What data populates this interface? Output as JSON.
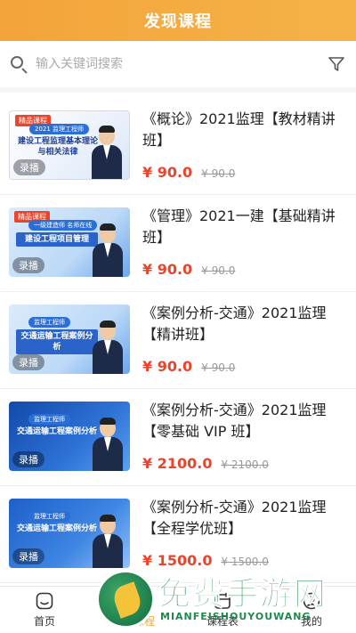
{
  "header": {
    "title": "发现课程"
  },
  "search": {
    "placeholder": "输入关键词搜索"
  },
  "courses": [
    {
      "title": "《概论》2021监理【教材精讲班】",
      "price": "¥ 90.0",
      "original_price": "¥ 90.0",
      "thumbnail": {
        "tag": "精品课程",
        "subtitle": "2021 监理工程师",
        "heading": "建设工程监理基本理论与相关法律",
        "badge": "录播"
      }
    },
    {
      "title": "《管理》2021一建【基础精讲班】",
      "price": "¥ 90.0",
      "original_price": "¥ 90.0",
      "thumbnail": {
        "tag": "精品课程",
        "subtitle": "一级建造师 名师在线",
        "heading": "建设工程项目管理",
        "badge": "录播"
      }
    },
    {
      "title": "《案例分析-交通》2021监理【精讲班】",
      "price": "¥ 90.0",
      "original_price": "¥ 90.0",
      "thumbnail": {
        "tag": "",
        "subtitle": "监理工程师",
        "heading": "交通运输工程案例分析",
        "badge": "录播"
      }
    },
    {
      "title": "《案例分析-交通》2021监理【零基础 VIP 班】",
      "price": "¥ 2100.0",
      "original_price": "¥ 2100.0",
      "thumbnail": {
        "tag": "",
        "subtitle": "监理工程师",
        "heading": "交通运输工程案例分析",
        "badge": "录播"
      }
    },
    {
      "title": "《案例分析-交通》2021监理【全程学优班】",
      "price": "¥ 1500.0",
      "original_price": "¥ 1500.0",
      "thumbnail": {
        "tag": "",
        "subtitle": "监理工程师",
        "heading": "交通运输工程案例分析",
        "badge": "录播"
      }
    }
  ],
  "tabbar": {
    "items": [
      {
        "label": "首页",
        "icon": "home-icon"
      },
      {
        "label": "发现课程",
        "icon": "discover-icon"
      },
      {
        "label": "课程表",
        "icon": "schedule-icon"
      },
      {
        "label": "我的",
        "icon": "user-icon"
      }
    ],
    "active_index": 1
  },
  "watermark": {
    "title": "免费手游网",
    "subtitle": "MIANFEISHOUYOUWANG"
  },
  "colors": {
    "accent": "#f3a43b",
    "price": "#e8452c"
  }
}
